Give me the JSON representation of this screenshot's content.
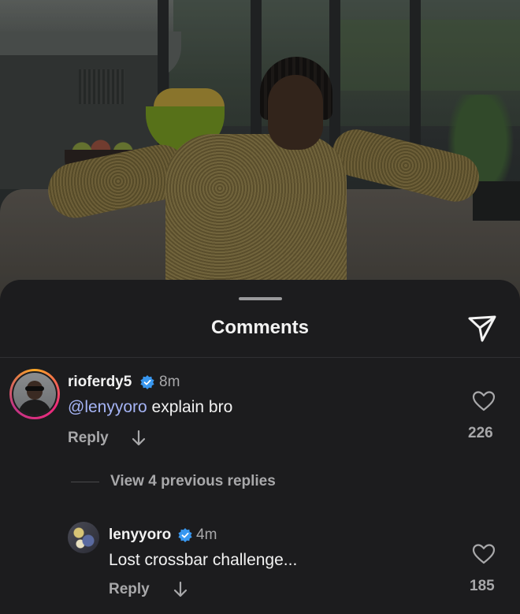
{
  "sheet": {
    "title": "Comments"
  },
  "comments": [
    {
      "username": "rioferdy5",
      "verified": true,
      "time": "8m",
      "mention": "@lenyyoro",
      "text": " explain bro",
      "reply_label": "Reply",
      "likes": "226"
    }
  ],
  "view_replies": "View 4 previous replies",
  "replies": [
    {
      "username": "lenyyoro",
      "verified": true,
      "time": "4m",
      "text": "Lost crossbar challenge...",
      "reply_label": "Reply",
      "likes": "185"
    }
  ],
  "colors": {
    "background": "#1c1c1e",
    "mention": "#a5b4f5",
    "verified": "#3897f0",
    "muted_text": "#a8a8aa"
  },
  "icons": [
    "send-icon",
    "verified-badge-icon",
    "arrow-down-icon",
    "heart-icon"
  ]
}
